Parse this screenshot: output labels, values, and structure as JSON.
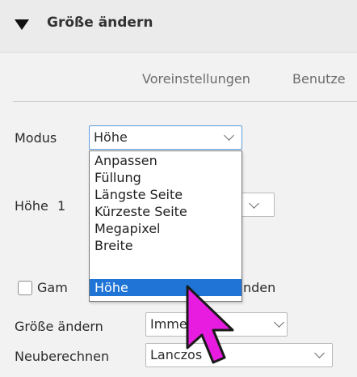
{
  "panel": {
    "title": "Größe ändern"
  },
  "presets": {
    "label": "Voreinstellungen",
    "value": "Benutze"
  },
  "mode": {
    "label": "Modus",
    "value": "Höhe",
    "options": [
      "Anpassen",
      "Füllung",
      "Längste Seite",
      "Kürzeste Seite",
      "Megapixel",
      "Breite",
      "Höhe"
    ],
    "selected": "Höhe"
  },
  "height": {
    "label": "Höhe",
    "value_fragment": "1"
  },
  "gamma": {
    "label_start": "Gam",
    "label_end": "nden"
  },
  "resize_when": {
    "label": "Größe ändern",
    "value": "Imme"
  },
  "resample": {
    "label": "Neuberechnen",
    "value": "Lanczos"
  },
  "colors": {
    "accent": "#1f74d6",
    "cursor": "#e81ce0"
  }
}
